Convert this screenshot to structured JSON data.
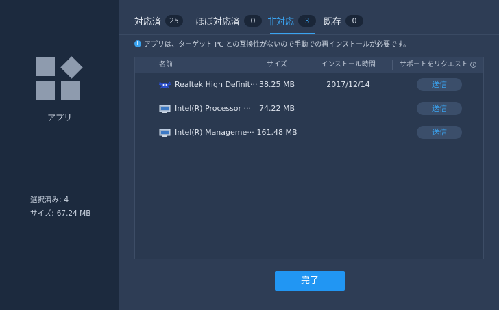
{
  "sidebar": {
    "app_label": "アプリ",
    "selected_label": "選択済み:",
    "selected_value": "4",
    "size_label": "サイズ:",
    "size_value": "67.24 MB"
  },
  "tabs": [
    {
      "label": "対応済",
      "count": "25"
    },
    {
      "label": "ほぼ対応済",
      "count": "0"
    },
    {
      "label": "非対応",
      "count": "3"
    },
    {
      "label": "既存",
      "count": "0"
    }
  ],
  "active_tab": "非対応",
  "info_text": "アプリは、ターゲット PC との互換性がないので手動での再インストールが必要です。",
  "table": {
    "headers": {
      "name": "名前",
      "size": "サイズ",
      "install_time": "インストール時間",
      "support": "サポートをリクエスト"
    },
    "rows": [
      {
        "name": "Realtek High Definit···",
        "size": "38.25 MB",
        "install_time": "2017/12/14",
        "action": "送信",
        "icon": "realtek-crab-icon"
      },
      {
        "name": "Intel(R) Processor ···",
        "size": "74.22 MB",
        "install_time": "",
        "action": "送信",
        "icon": "installer-icon"
      },
      {
        "name": "Intel(R) Manageme···",
        "size": "161.48 MB",
        "install_time": "",
        "action": "送信",
        "icon": "installer-icon"
      }
    ]
  },
  "done_button": "完了",
  "colors": {
    "accent": "#2196f3",
    "active_tab": "#3aa3f0",
    "sidebar_bg": "#1c2a3e",
    "main_bg": "#2e3d55"
  }
}
